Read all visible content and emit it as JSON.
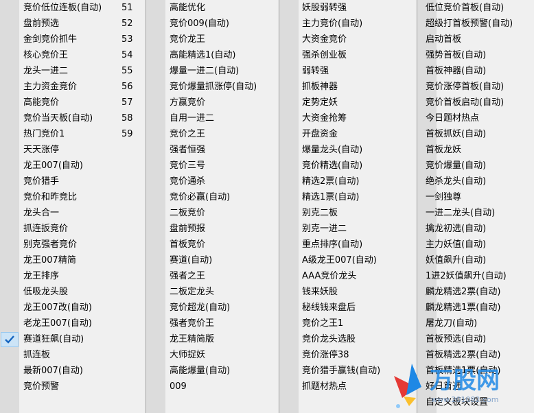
{
  "columns": [
    {
      "items": [
        {
          "label": "竞价低位连板(自动)",
          "num": "51"
        },
        {
          "label": "盘前预选",
          "num": "52"
        },
        {
          "label": "金剑竞价抓牛",
          "num": "53"
        },
        {
          "label": "核心竞价王",
          "num": "54"
        },
        {
          "label": "龙头一进二",
          "num": "55"
        },
        {
          "label": "主力资金竞价",
          "num": "56"
        },
        {
          "label": "高能竞价",
          "num": "57"
        },
        {
          "label": "竞价当天板(自动)",
          "num": "58"
        },
        {
          "label": "热门竞价1",
          "num": "59"
        },
        {
          "label": "天天涨停"
        },
        {
          "label": "龙王007(自动)"
        },
        {
          "label": "竞价猎手"
        },
        {
          "label": "竞价和昨竞比"
        },
        {
          "label": "龙头合一"
        },
        {
          "label": "抓连扳竞价"
        },
        {
          "label": "别克强者竞价"
        },
        {
          "label": "龙王007精简"
        },
        {
          "label": "龙王排序"
        },
        {
          "label": "低吸龙头股"
        },
        {
          "label": "龙王007改(自动)"
        },
        {
          "label": "老龙王007(自动)"
        },
        {
          "label": "赛道狂飙(自动)",
          "checked": true
        },
        {
          "label": "抓连板"
        },
        {
          "label": "最新007(自动)"
        },
        {
          "label": "竞价预警"
        }
      ]
    },
    {
      "items": [
        {
          "label": "高能优化"
        },
        {
          "label": "竞价009(自动)"
        },
        {
          "label": "竞价龙王"
        },
        {
          "label": "高能精选1(自动)"
        },
        {
          "label": "爆量一进二(自动)"
        },
        {
          "label": "竞价爆量抓涨停(自动)"
        },
        {
          "label": "方赢竞价"
        },
        {
          "label": "自用一进二"
        },
        {
          "label": "竞价之王"
        },
        {
          "label": "强者恒强"
        },
        {
          "label": "竞价三号"
        },
        {
          "label": "竞价通杀"
        },
        {
          "label": "竞价必赢(自动)"
        },
        {
          "label": "二板竞价"
        },
        {
          "label": "盘前预报"
        },
        {
          "label": "首板竞价"
        },
        {
          "label": "赛道(自动)"
        },
        {
          "label": "强者之王"
        },
        {
          "label": "二板定龙头"
        },
        {
          "label": "竞价超龙(自动)"
        },
        {
          "label": "强者竞价王"
        },
        {
          "label": "龙王精简版"
        },
        {
          "label": "大师捉妖"
        },
        {
          "label": "高能爆量(自动)"
        },
        {
          "label": "009"
        }
      ]
    },
    {
      "items": [
        {
          "label": "妖股弱转强"
        },
        {
          "label": "主力竞价(自动)"
        },
        {
          "label": "大资金竞价"
        },
        {
          "label": "强杀创业板"
        },
        {
          "label": "弱转强"
        },
        {
          "label": "抓板神器"
        },
        {
          "label": "定势定妖"
        },
        {
          "label": "大资金抢筹"
        },
        {
          "label": "开盘资金"
        },
        {
          "label": "爆量龙头(自动)"
        },
        {
          "label": "竞价精选(自动)"
        },
        {
          "label": "精选2票(自动)"
        },
        {
          "label": "精选1票(自动)"
        },
        {
          "label": "别克二板"
        },
        {
          "label": "别克一进二"
        },
        {
          "label": "重点排序(自动)"
        },
        {
          "label": "A级龙王007(自动)"
        },
        {
          "label": "AAA竞价龙头"
        },
        {
          "label": "钱来妖股"
        },
        {
          "label": "秘线钱来盘后"
        },
        {
          "label": "竞价之王1"
        },
        {
          "label": "竞价龙头选股"
        },
        {
          "label": "竞价涨停38"
        },
        {
          "label": "竞价猎手赢钱(自动)"
        },
        {
          "label": "抓题材热点"
        }
      ]
    },
    {
      "items": [
        {
          "label": "低位竞价首板(自动)"
        },
        {
          "label": "超级打首板预警(自动)"
        },
        {
          "label": "启动首板"
        },
        {
          "label": "强势首板(自动)"
        },
        {
          "label": "首板神器(自动)"
        },
        {
          "label": "竞价涨停首板(自动)"
        },
        {
          "label": "竞价首板启动(自动)"
        },
        {
          "label": "今日题材热点"
        },
        {
          "label": "首板抓妖(自动)"
        },
        {
          "label": "首板龙妖"
        },
        {
          "label": "竞价爆量(自动)"
        },
        {
          "label": "绝杀龙头(自动)"
        },
        {
          "label": "一剑独尊"
        },
        {
          "label": "一进二龙头(自动)"
        },
        {
          "label": "擒龙初选(自动)"
        },
        {
          "label": "主力妖值(自动)"
        },
        {
          "label": "妖值飙升(自动)"
        },
        {
          "label": "1进2妖值飙升(自动)"
        },
        {
          "label": "麟龙精选2票(自动)"
        },
        {
          "label": "麟龙精选1票(自动)"
        },
        {
          "label": "屠龙刀(自动)"
        },
        {
          "label": "首板预选(自动)"
        },
        {
          "label": "首板精选2票(自动)"
        },
        {
          "label": "首板精选1票(自动)"
        },
        {
          "label": "好日首选"
        },
        {
          "label": "自定义板块设置"
        }
      ]
    }
  ],
  "watermark": {
    "brand": "万股网",
    "url": "www.201082.com"
  },
  "colors": {
    "menu_bg": "#f0f0f0",
    "gutter": "#dcdcdc",
    "check_bg": "#cce4f7",
    "check_mark": "#1565c0"
  }
}
